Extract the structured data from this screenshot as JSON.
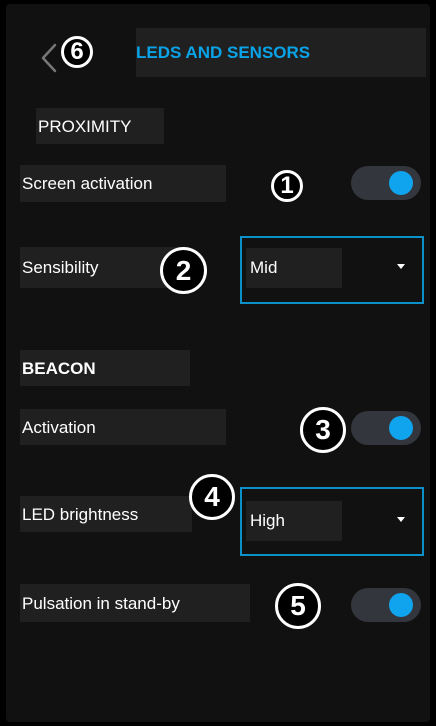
{
  "header": {
    "title": "LEDS AND SENSORS",
    "back_marker": "6"
  },
  "sections": {
    "proximity": "PROXIMITY",
    "beacon": "BEACON"
  },
  "settings": {
    "screen_activation": {
      "label": "Screen activation",
      "marker": "1",
      "state": "on"
    },
    "sensibility": {
      "label": "Sensibility",
      "marker": "2",
      "value": "Mid"
    },
    "activation": {
      "label": "Activation",
      "marker": "3",
      "state": "on"
    },
    "led_brightness": {
      "label": "LED brightness",
      "marker": "4",
      "value": "High"
    },
    "pulsation": {
      "label": "Pulsation in stand-by",
      "marker": "5",
      "state": "on"
    }
  },
  "colors": {
    "accent": "#10a4ee",
    "title": "#0aa3e8",
    "background": "#111111",
    "panel": "#202020",
    "toggle_track": "#34363d"
  },
  "icons": {
    "back": "chevron-left-icon",
    "select": "caret-down-icon"
  }
}
